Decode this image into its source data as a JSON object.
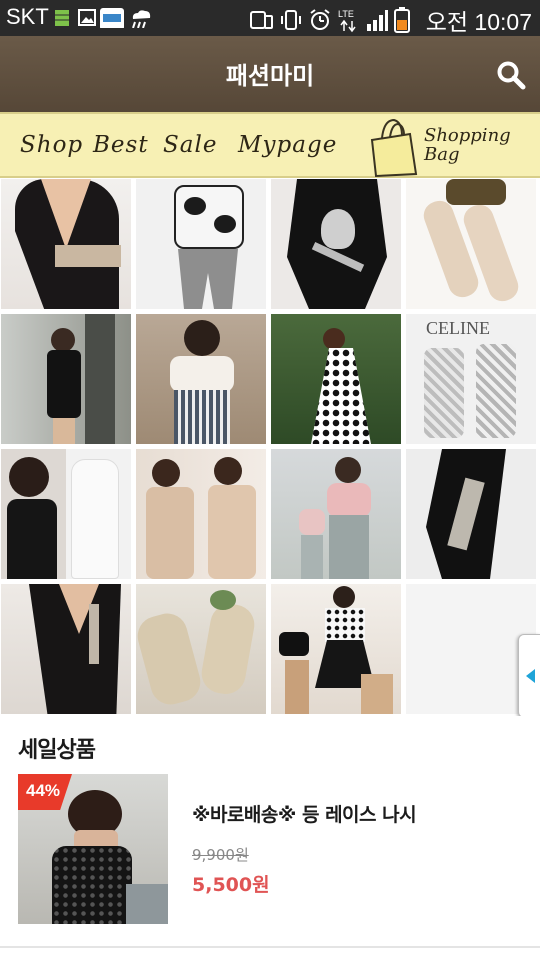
{
  "status_bar": {
    "carrier": "SKT",
    "network": "LTE",
    "time": "오전 10:07"
  },
  "header": {
    "title": "패션마미",
    "search_icon": "search-icon",
    "bg_color": "#5d4e3d"
  },
  "nav": {
    "items": [
      {
        "label": "Shop"
      },
      {
        "label": "Best"
      },
      {
        "label": "Sale"
      },
      {
        "label": "Mypage"
      }
    ],
    "bag_label_line1": "Shopping",
    "bag_label_line2": "Bag",
    "bag_icon": "shopping-bag-icon",
    "bg_color": "#f7f0b4"
  },
  "grid": {
    "products": [
      {
        "id": "p1"
      },
      {
        "id": "p2"
      },
      {
        "id": "p3"
      },
      {
        "id": "p4"
      },
      {
        "id": "p5"
      },
      {
        "id": "p6"
      },
      {
        "id": "p7"
      },
      {
        "id": "p8"
      },
      {
        "id": "p9"
      },
      {
        "id": "p10"
      },
      {
        "id": "p11"
      },
      {
        "id": "p12"
      },
      {
        "id": "p13"
      },
      {
        "id": "p14"
      },
      {
        "id": "p15"
      }
    ]
  },
  "sale": {
    "heading": "세일상품",
    "item": {
      "discount": "44%",
      "name": "※바로배송※ 등 레이스 나시",
      "original_price": "9,900원",
      "price": "5,500원"
    },
    "price_color": "#e05454",
    "badge_color": "#e83a2a"
  }
}
